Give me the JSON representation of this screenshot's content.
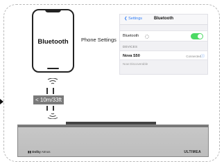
{
  "phone": {
    "screen_label": "Bluetooth"
  },
  "phone_settings_label": "Phone Settings",
  "settings_panel": {
    "back_label": "Settings",
    "title": "Bluetooth",
    "bluetooth_row_label": "Bluetooth",
    "bluetooth_on": true,
    "section_header": "DEVICES",
    "device_name": "Nova S50",
    "device_status": "Connected",
    "info_icon": "info-icon",
    "discoverable_text": "Now Discoverable"
  },
  "distance_label": "< 10m/33ft",
  "soundbar": {
    "dolby_prefix": "Dolby",
    "dolby_suffix": " Atmos",
    "brand": "ULTIMEA"
  },
  "colors": {
    "toggle_on": "#4cd964",
    "accent": "#2f7df6",
    "distance_badge": "#7a7a7a"
  }
}
